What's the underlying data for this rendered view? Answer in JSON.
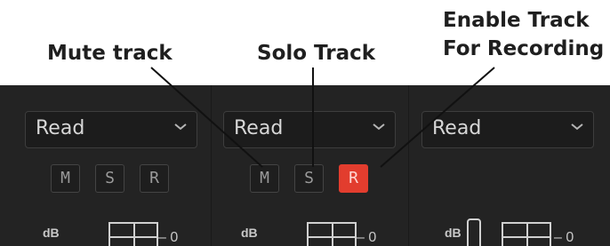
{
  "callouts": {
    "mute": "Mute track",
    "solo": "Solo Track",
    "record_line1": "Enable Track",
    "record_line2": "For Recording"
  },
  "tracks": [
    {
      "mode": "Read",
      "mute": "M",
      "solo": "S",
      "record": "R",
      "db_label": "dB",
      "zero_label": "0",
      "record_enabled": false
    },
    {
      "mode": "Read",
      "mute": "M",
      "solo": "S",
      "record": "R",
      "db_label": "dB",
      "zero_label": "0",
      "record_enabled": true
    },
    {
      "mode": "Read",
      "db_label": "dB",
      "zero_label": "0"
    }
  ],
  "icons": {
    "dropdown": "chevron-down-icon"
  },
  "colors": {
    "panel": "#232323",
    "record_active": "#e23d2e",
    "callout_text": "#1f1f1f"
  }
}
